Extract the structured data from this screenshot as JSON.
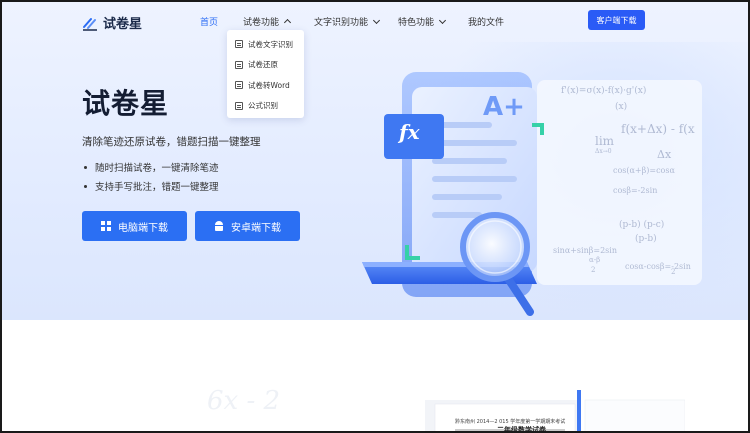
{
  "nav": {
    "logo": "试卷星",
    "items": [
      {
        "label": "首页",
        "active": true,
        "chevron": false
      },
      {
        "label": "试卷功能",
        "active": false,
        "chevron": "up"
      },
      {
        "label": "文字识别功能",
        "active": false,
        "chevron": "down"
      },
      {
        "label": "特色功能",
        "active": false,
        "chevron": "down"
      },
      {
        "label": "我的文件",
        "active": false,
        "chevron": false
      }
    ],
    "download_button": "客户端下载"
  },
  "dropdown": {
    "items": [
      {
        "label": "试卷文字识别",
        "icon": "doc-text-icon"
      },
      {
        "label": "试卷还原",
        "icon": "doc-restore-icon"
      },
      {
        "label": "试卷转Word",
        "icon": "word-convert-icon"
      },
      {
        "label": "公式识别",
        "icon": "formula-icon"
      }
    ]
  },
  "hero": {
    "title": "试卷星",
    "subtitle": "清除笔迹还原试卷，错题扫描一键整理",
    "bullets": [
      "随时扫描试卷，一键清除笔迹",
      "支持手写批注，错题一键整理"
    ],
    "pc_download": "电脑端下载",
    "android_download": "安卓端下载"
  },
  "illustration": {
    "fx_label": "fx",
    "a_plus_label": "A+",
    "formulas": [
      "f'(x)=σ(x)-f(x)·g'(x)",
      "(x)",
      "f(x+Δx) - f(x",
      "lim",
      "Δx→0",
      "Δx",
      "cos(α+β)=cosα",
      "cosβ=-2sin",
      "(p-b)  (p-c)",
      "(p-b)",
      "sinα+sinβ=2sin",
      "α-β",
      "2",
      "cosα-cosβ=-2sin",
      "2"
    ]
  },
  "lower": {
    "ghost_formula": "6x - 2",
    "paper_header": "黔东南州 2014—2 015 学年度第一学期期末考试",
    "paper_title": "二年级数学试卷"
  },
  "colors": {
    "accent": "#2a6cf5",
    "button": "#2b6ff3",
    "title": "#141d33"
  }
}
